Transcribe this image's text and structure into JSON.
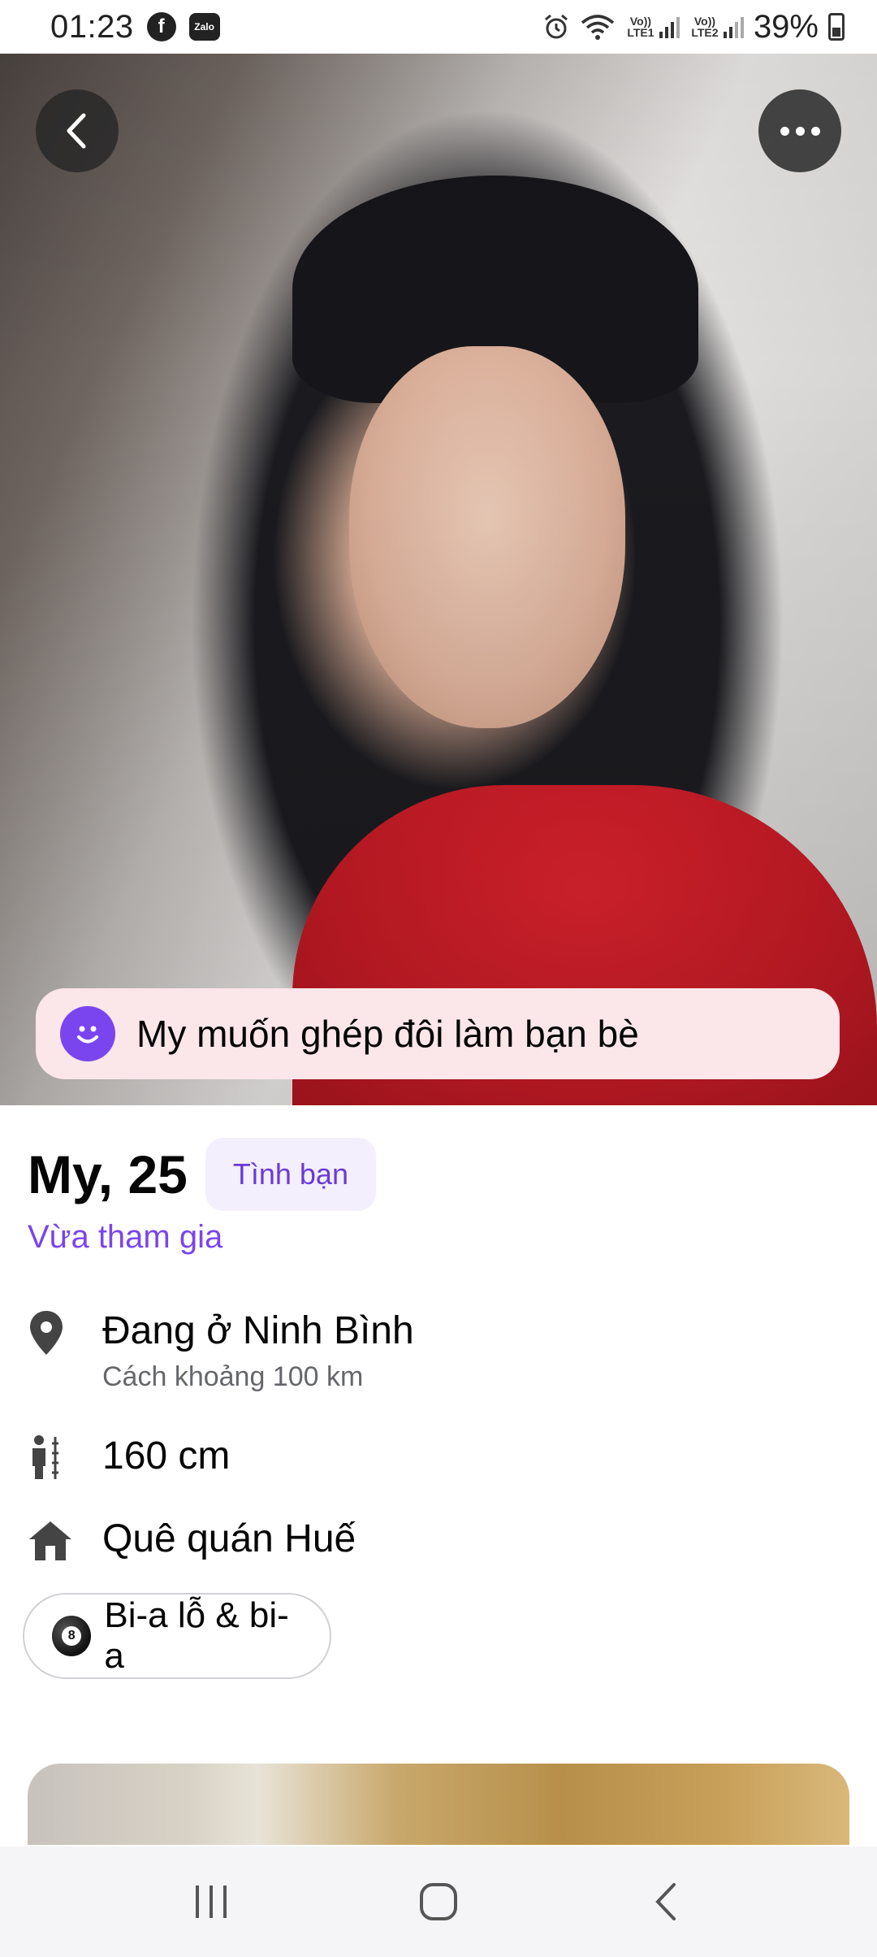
{
  "status_bar": {
    "time": "01:23",
    "notification_icons": [
      "facebook-icon",
      "zalo-icon"
    ],
    "zalo_label": "Zalo",
    "sim1_label": "Vo)) LTE1",
    "sim2_label": "Vo)) LTE2",
    "battery": "39%"
  },
  "profile": {
    "name_age": "My, 25",
    "tag": "Tình bạn",
    "joined": "Vừa tham gia",
    "match_intent": "My muốn ghép đôi làm bạn bè",
    "location": {
      "title": "Đang ở Ninh Bình",
      "distance": "Cách  khoảng 100 km"
    },
    "height": "160 cm",
    "hometown": "Quê quán Huế",
    "interests": [
      {
        "label": "Bi-a lỗ & bi-a",
        "icon": "billiard-ball-icon",
        "ball_number": "8"
      }
    ]
  },
  "colors": {
    "accent": "#7a45ee",
    "tag_bg": "#f3effd",
    "banner_bg": "#fbe6ea"
  }
}
